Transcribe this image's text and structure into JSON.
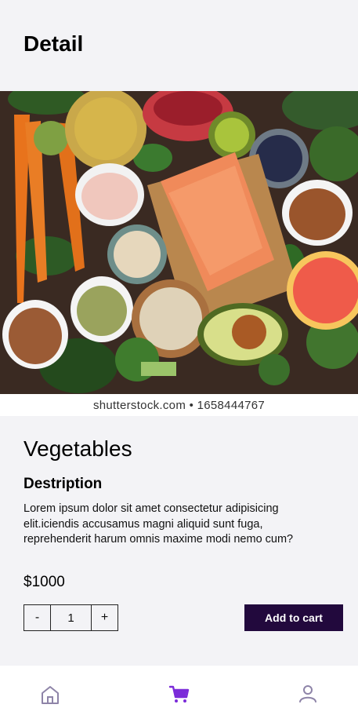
{
  "header": {
    "title": "Detail"
  },
  "hero": {
    "alt": "Assorted healthy foods: salmon, vegetables, nuts and fruits",
    "watermark": "shutterstock.com • 1658444767"
  },
  "product": {
    "name": "Vegetables",
    "description_heading": "Destription",
    "description": "Lorem ipsum dolor sit amet consectetur adipisicing elit.iciendis accusamus magni aliquid sunt fuga, reprehenderit harum omnis maxime modi nemo cum?",
    "price": "$1000"
  },
  "quantity": {
    "decrement": "-",
    "value": "1",
    "increment": "+"
  },
  "actions": {
    "add_to_cart": "Add to cart"
  },
  "bottom_nav": {
    "items": [
      {
        "icon": "home-icon",
        "active": false
      },
      {
        "icon": "cart-icon",
        "active": true
      },
      {
        "icon": "user-icon",
        "active": false
      }
    ]
  },
  "colors": {
    "accent": "#22093d",
    "active_nav": "#7b2bd9",
    "inactive_nav": "#8e84a8"
  }
}
